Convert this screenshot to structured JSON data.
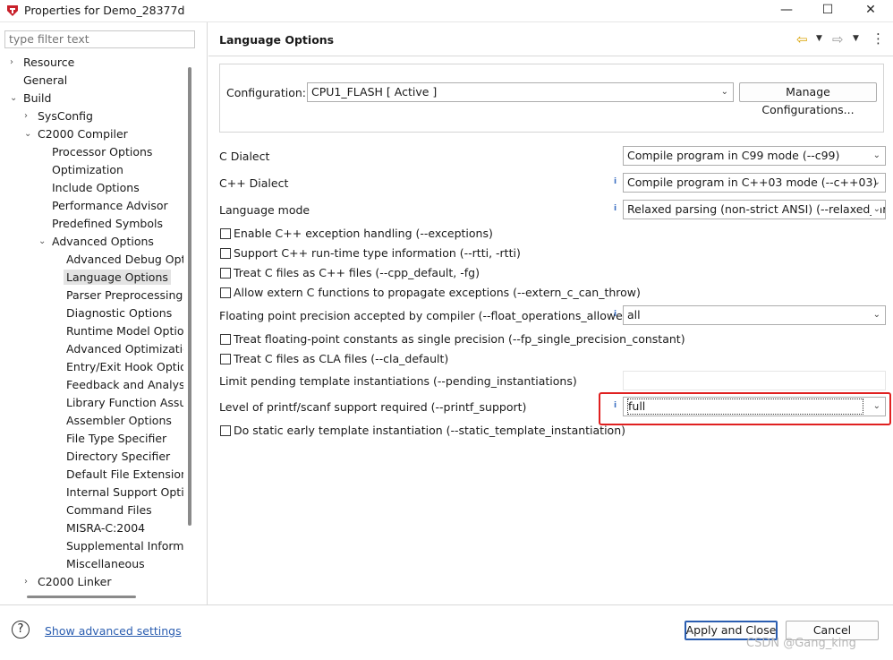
{
  "window": {
    "title": "Properties for Demo_28377d",
    "minimize_glyph": "—",
    "maximize_glyph": "☐",
    "close_glyph": "✕"
  },
  "filter": {
    "placeholder": "type filter text"
  },
  "tree": [
    {
      "label": "Resource",
      "indent": 0,
      "arrow": "›"
    },
    {
      "label": "General",
      "indent": 0,
      "arrow": ""
    },
    {
      "label": "Build",
      "indent": 0,
      "arrow": "⌄"
    },
    {
      "label": "SysConfig",
      "indent": 1,
      "arrow": "›"
    },
    {
      "label": "C2000 Compiler",
      "indent": 1,
      "arrow": "⌄"
    },
    {
      "label": "Processor Options",
      "indent": 2,
      "arrow": ""
    },
    {
      "label": "Optimization",
      "indent": 2,
      "arrow": ""
    },
    {
      "label": "Include Options",
      "indent": 2,
      "arrow": ""
    },
    {
      "label": "Performance Advisor",
      "indent": 2,
      "arrow": ""
    },
    {
      "label": "Predefined Symbols",
      "indent": 2,
      "arrow": ""
    },
    {
      "label": "Advanced Options",
      "indent": 2,
      "arrow": "⌄"
    },
    {
      "label": "Advanced Debug Opti",
      "indent": 3,
      "arrow": ""
    },
    {
      "label": "Language Options",
      "indent": 3,
      "arrow": "",
      "selected": true
    },
    {
      "label": "Parser Preprocessing (",
      "indent": 3,
      "arrow": ""
    },
    {
      "label": "Diagnostic Options",
      "indent": 3,
      "arrow": ""
    },
    {
      "label": "Runtime Model Option",
      "indent": 3,
      "arrow": ""
    },
    {
      "label": "Advanced Optimizatio",
      "indent": 3,
      "arrow": ""
    },
    {
      "label": "Entry/Exit Hook Option",
      "indent": 3,
      "arrow": ""
    },
    {
      "label": "Feedback and Analysis",
      "indent": 3,
      "arrow": ""
    },
    {
      "label": "Library Function Assum",
      "indent": 3,
      "arrow": ""
    },
    {
      "label": "Assembler Options",
      "indent": 3,
      "arrow": ""
    },
    {
      "label": "File Type Specifier",
      "indent": 3,
      "arrow": ""
    },
    {
      "label": "Directory Specifier",
      "indent": 3,
      "arrow": ""
    },
    {
      "label": "Default File Extensions",
      "indent": 3,
      "arrow": ""
    },
    {
      "label": "Internal Support Optic",
      "indent": 3,
      "arrow": ""
    },
    {
      "label": "Command Files",
      "indent": 3,
      "arrow": ""
    },
    {
      "label": "MISRA-C:2004",
      "indent": 3,
      "arrow": ""
    },
    {
      "label": "Supplemental Informa",
      "indent": 3,
      "arrow": ""
    },
    {
      "label": "Miscellaneous",
      "indent": 3,
      "arrow": ""
    },
    {
      "label": "C2000 Linker",
      "indent": 1,
      "arrow": "›"
    }
  ],
  "page": {
    "title": "Language Options",
    "nav_back": "⇦",
    "nav_forward": "⇨",
    "menu_glyph": "⋮"
  },
  "configuration": {
    "label": "Configuration:",
    "value": "CPU1_FLASH  [ Active ]",
    "manage_button": "Manage Configurations..."
  },
  "options": {
    "c_dialect_label": "C Dialect",
    "c_dialect_value": "Compile program in C99 mode (--c99)",
    "cpp_dialect_label": "C++ Dialect",
    "cpp_dialect_value": "Compile program in C++03 mode (--c++03)",
    "lang_mode_label": "Language mode",
    "lang_mode_value": "Relaxed parsing (non-strict ANSI) (--relaxed_ar",
    "exceptions_label": "Enable C++ exception handling (--exceptions)",
    "rtti_label": "Support C++ run-time type information (--rtti, -rtti)",
    "cpp_default_label": "Treat C files as C++ files (--cpp_default, -fg)",
    "extern_c_label": "Allow extern C functions to propagate exceptions (--extern_c_can_throw)",
    "float_ops_label": "Floating point precision accepted by compiler (--float_operations_allowed)",
    "float_ops_value": "all",
    "fp_single_label": "Treat floating-point constants as single precision (--fp_single_precision_constant)",
    "cla_default_label": "Treat C files as CLA files (--cla_default)",
    "pending_label": "Limit pending template instantiations (--pending_instantiations)",
    "pending_value": "",
    "printf_label": "Level of printf/scanf support required (--printf_support)",
    "printf_value": "full",
    "static_template_label": "Do static early template instantiation (--static_template_instantiation)"
  },
  "footer": {
    "help_glyph": "?",
    "advanced_link": "Show advanced settings",
    "apply_close": "Apply and Close",
    "cancel": "Cancel"
  },
  "watermark": "CSDN @Gang_king",
  "colors": {
    "highlight": "#e02020",
    "link": "#2a5db0",
    "info": "#3b6fc2"
  }
}
